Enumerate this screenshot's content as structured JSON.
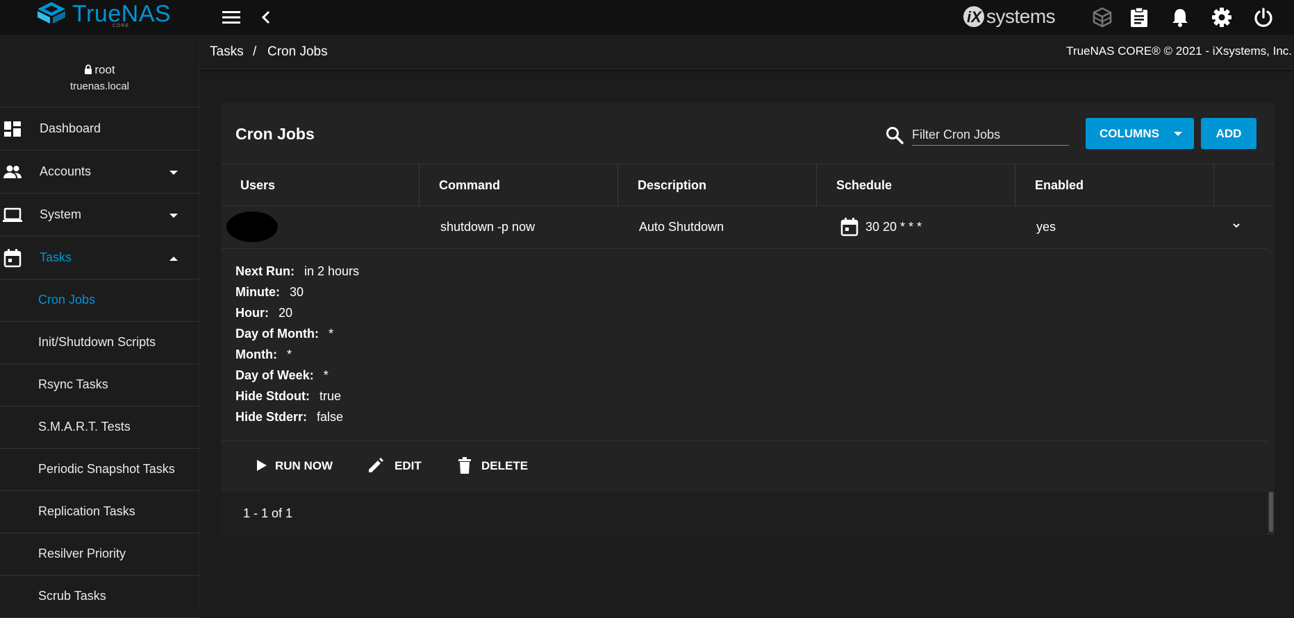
{
  "app": {
    "logo_text": "TrueNAS",
    "logo_sub": "CORE",
    "vendor_logo_text": "systems"
  },
  "topbar": {
    "icons": [
      "menu-icon",
      "back-icon",
      "truecommand-icon",
      "task-manager-icon",
      "notifications-icon",
      "settings-icon",
      "power-icon"
    ]
  },
  "user": {
    "name": "root",
    "host": "truenas.local"
  },
  "sidebar": {
    "items": [
      {
        "label": "Dashboard",
        "icon": "dashboard-icon"
      },
      {
        "label": "Accounts",
        "icon": "accounts-icon"
      },
      {
        "label": "System",
        "icon": "system-icon"
      },
      {
        "label": "Tasks",
        "icon": "tasks-icon"
      }
    ],
    "sub_items": [
      {
        "label": "Cron Jobs"
      },
      {
        "label": "Init/Shutdown Scripts"
      },
      {
        "label": "Rsync Tasks"
      },
      {
        "label": "S.M.A.R.T. Tests"
      },
      {
        "label": "Periodic Snapshot Tasks"
      },
      {
        "label": "Replication Tasks"
      },
      {
        "label": "Resilver Priority"
      },
      {
        "label": "Scrub Tasks"
      }
    ]
  },
  "breadcrumb": {
    "parent": "Tasks",
    "separator": "/",
    "current": "Cron Jobs",
    "copyright": "TrueNAS CORE® © 2021 - iXsystems, Inc."
  },
  "card": {
    "title": "Cron Jobs",
    "filter_placeholder": "Filter Cron Jobs",
    "columns_label": "COLUMNS",
    "add_label": "ADD"
  },
  "table": {
    "headers": [
      "Users",
      "Command",
      "Description",
      "Schedule",
      "Enabled"
    ],
    "row": {
      "user": "",
      "command": "shutdown -p now",
      "description": "Auto Shutdown",
      "schedule": "30 20 * * *",
      "enabled": "yes"
    }
  },
  "details": [
    {
      "key": "Next Run:",
      "value": "in 2 hours"
    },
    {
      "key": "Minute:",
      "value": "30"
    },
    {
      "key": "Hour:",
      "value": "20"
    },
    {
      "key": "Day of Month:",
      "value": "*"
    },
    {
      "key": "Month:",
      "value": "*"
    },
    {
      "key": "Day of Week:",
      "value": "*"
    },
    {
      "key": "Hide Stdout:",
      "value": "true"
    },
    {
      "key": "Hide Stderr:",
      "value": "false"
    }
  ],
  "actions": {
    "run_now": "RUN NOW",
    "edit": "EDIT",
    "delete": "DELETE"
  },
  "pagination": {
    "text": "1 - 1 of 1"
  },
  "colors": {
    "accent": "#0095d5",
    "background": "#1c1c1c",
    "card": "#232323",
    "topbar": "#111111"
  }
}
